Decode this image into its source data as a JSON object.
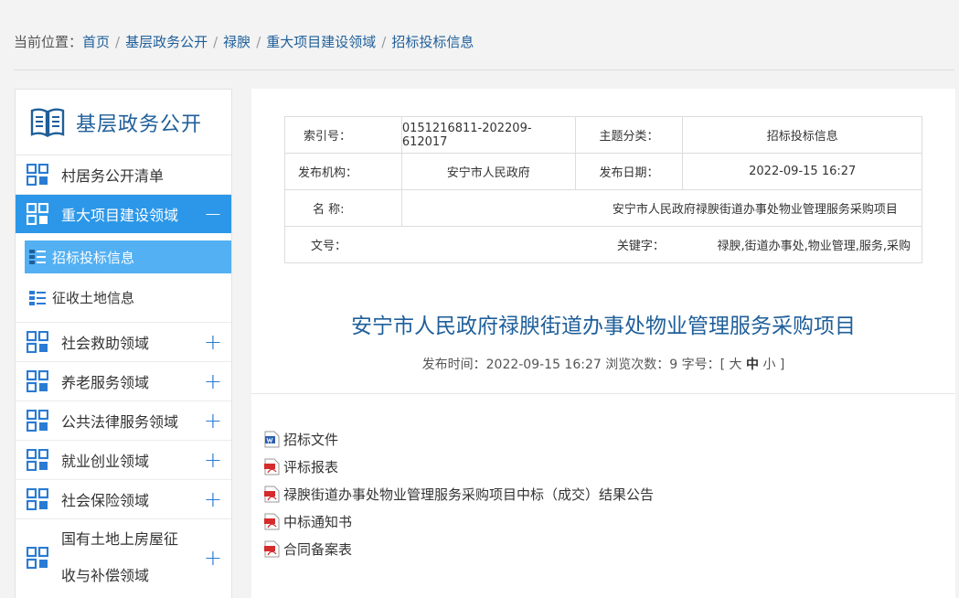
{
  "breadcrumb": {
    "prefix": "当前位置：",
    "items": [
      "首页",
      "基层政务公开",
      "禄腴",
      "重大项目建设领域",
      "招标投标信息"
    ]
  },
  "sidebar": {
    "title": "基层政务公开",
    "items": [
      {
        "label": "村居务公开清单",
        "expander": ""
      },
      {
        "label": "重大项目建设领域",
        "expander": "−",
        "active": true,
        "subitems": [
          {
            "label": "招标投标信息",
            "active": true
          },
          {
            "label": "征收土地信息"
          }
        ]
      },
      {
        "label": "社会救助领域",
        "expander": "+"
      },
      {
        "label": "养老服务领域",
        "expander": "+"
      },
      {
        "label": "公共法律服务领域",
        "expander": "+"
      },
      {
        "label": "就业创业领域",
        "expander": "+"
      },
      {
        "label": "社会保险领域",
        "expander": "+"
      },
      {
        "label_line1": "国有土地上房屋征",
        "label_line2": "收与补偿领域",
        "expander": "+"
      }
    ]
  },
  "meta": {
    "index_label": "索引号：",
    "index_value": "0151216811-202209-612017",
    "topic_label": "主题分类：",
    "topic_value": "招标投标信息",
    "org_label": "发布机构：",
    "org_value": "安宁市人民政府",
    "date_label": "发布日期：",
    "date_value": "2022-09-15 16:27",
    "name_label": "名  称:",
    "name_value": "安宁市人民政府禄腴街道办事处物业管理服务采购项目",
    "doc_label": "文号：",
    "doc_value": "",
    "keyword_label": "关键字：",
    "keyword_value": "禄腴,街道办事处,物业管理,服务,采购"
  },
  "article": {
    "title": "安宁市人民政府禄腴街道办事处物业管理服务采购项目",
    "pub_time_label": "发布时间：",
    "pub_time": "2022-09-15 16:27",
    "views_label": "浏览次数：",
    "views": "9",
    "fontsize_label": "字号：[",
    "size_large": "大",
    "size_medium": "中",
    "size_small": "小",
    "fontsize_end": "]"
  },
  "attachments": [
    {
      "name": "招标文件",
      "icon": "word-doc-icon"
    },
    {
      "name": "评标报表",
      "icon": "pdf-icon"
    },
    {
      "name": "禄腴街道办事处物业管理服务采购项目中标（成交）结果公告",
      "icon": "pdf-icon"
    },
    {
      "name": "中标通知书",
      "icon": "pdf-icon"
    },
    {
      "name": "合同备案表",
      "icon": "pdf-icon"
    }
  ],
  "colors": {
    "accent": "#2c97e8",
    "link": "#1f5f9a",
    "sub_active": "#53b0f3",
    "pdf_red": "#d42c2c"
  }
}
